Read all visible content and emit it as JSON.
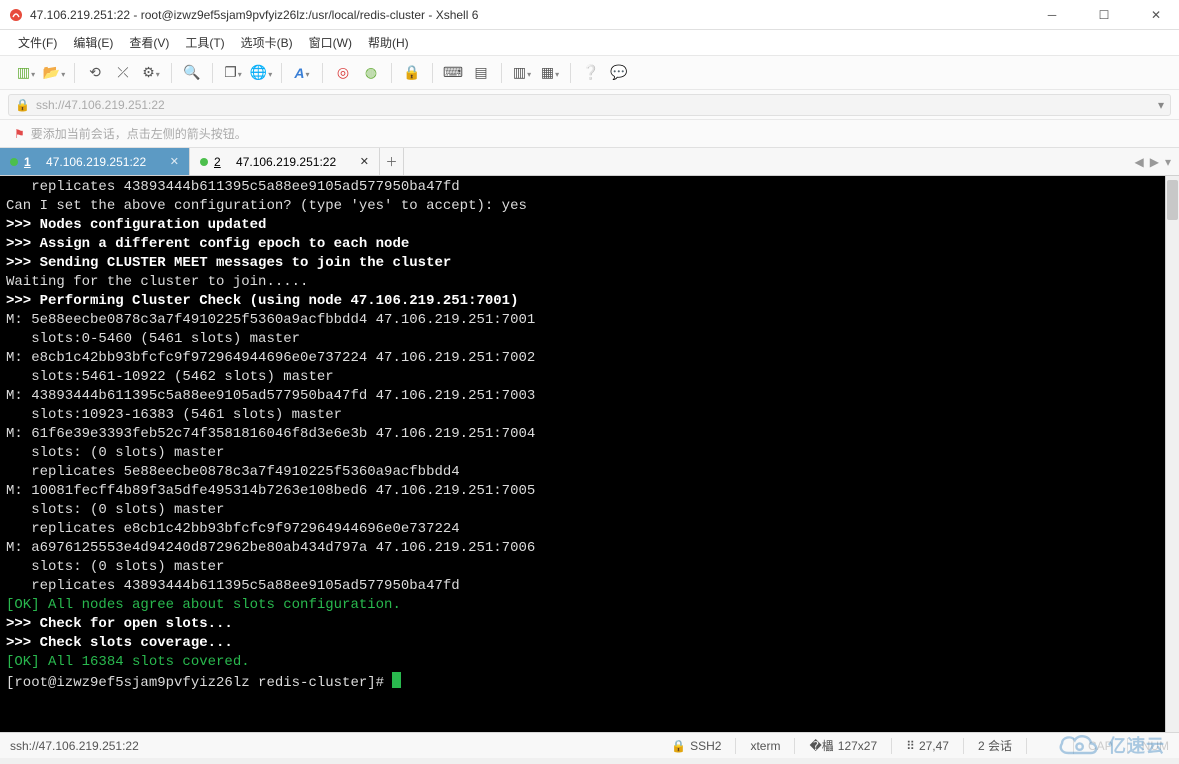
{
  "window": {
    "title": "47.106.219.251:22 - root@izwz9ef5sjam9pvfyiz26lz:/usr/local/redis-cluster - Xshell 6"
  },
  "menu": {
    "file": "文件(F)",
    "edit": "编辑(E)",
    "view": "查看(V)",
    "tools": "工具(T)",
    "tabs": "选项卡(B)",
    "window": "窗口(W)",
    "help": "帮助(H)"
  },
  "address": {
    "url": "ssh://47.106.219.251:22"
  },
  "hint": {
    "text": "要添加当前会话，点击左侧的箭头按钮。"
  },
  "tabs": [
    {
      "index": "1",
      "label": "47.106.219.251:22",
      "active": true
    },
    {
      "index": "2",
      "label": "47.106.219.251:22",
      "active": false
    }
  ],
  "terminal": {
    "lines": [
      {
        "cls": "",
        "text": "   replicates 43893444b611395c5a88ee9105ad577950ba47fd"
      },
      {
        "cls": "",
        "text": "Can I set the above configuration? (type 'yes' to accept): yes"
      },
      {
        "cls": "w",
        "text": ">>> Nodes configuration updated"
      },
      {
        "cls": "w",
        "text": ">>> Assign a different config epoch to each node"
      },
      {
        "cls": "w",
        "text": ">>> Sending CLUSTER MEET messages to join the cluster"
      },
      {
        "cls": "",
        "text": "Waiting for the cluster to join....."
      },
      {
        "cls": "w",
        "text": ">>> Performing Cluster Check (using node 47.106.219.251:7001)"
      },
      {
        "cls": "",
        "text": "M: 5e88eecbe0878c3a7f4910225f5360a9acfbbdd4 47.106.219.251:7001"
      },
      {
        "cls": "",
        "text": "   slots:0-5460 (5461 slots) master"
      },
      {
        "cls": "",
        "text": "M: e8cb1c42bb93bfcfc9f972964944696e0e737224 47.106.219.251:7002"
      },
      {
        "cls": "",
        "text": "   slots:5461-10922 (5462 slots) master"
      },
      {
        "cls": "",
        "text": "M: 43893444b611395c5a88ee9105ad577950ba47fd 47.106.219.251:7003"
      },
      {
        "cls": "",
        "text": "   slots:10923-16383 (5461 slots) master"
      },
      {
        "cls": "",
        "text": "M: 61f6e39e3393feb52c74f3581816046f8d3e6e3b 47.106.219.251:7004"
      },
      {
        "cls": "",
        "text": "   slots: (0 slots) master"
      },
      {
        "cls": "",
        "text": "   replicates 5e88eecbe0878c3a7f4910225f5360a9acfbbdd4"
      },
      {
        "cls": "",
        "text": "M: 10081fecff4b89f3a5dfe495314b7263e108bed6 47.106.219.251:7005"
      },
      {
        "cls": "",
        "text": "   slots: (0 slots) master"
      },
      {
        "cls": "",
        "text": "   replicates e8cb1c42bb93bfcfc9f972964944696e0e737224"
      },
      {
        "cls": "",
        "text": "M: a6976125553e4d94240d872962be80ab434d797a 47.106.219.251:7006"
      },
      {
        "cls": "",
        "text": "   slots: (0 slots) master"
      },
      {
        "cls": "",
        "text": "   replicates 43893444b611395c5a88ee9105ad577950ba47fd"
      },
      {
        "cls": "g",
        "text": "[OK] All nodes agree about slots configuration."
      },
      {
        "cls": "w",
        "text": ">>> Check for open slots..."
      },
      {
        "cls": "w",
        "text": ">>> Check slots coverage..."
      },
      {
        "cls": "g",
        "text": "[OK] All 16384 slots covered."
      }
    ],
    "prompt": "[root@izwz9ef5sjam9pvfyiz26lz redis-cluster]# "
  },
  "status": {
    "addr": "ssh://47.106.219.251:22",
    "proto": "SSH2",
    "term": "xterm",
    "size": "127x27",
    "pos": "27,47",
    "sessions": "2 会话",
    "caps": "CAP",
    "num": "NUM"
  },
  "watermark": {
    "text": "亿速云"
  }
}
